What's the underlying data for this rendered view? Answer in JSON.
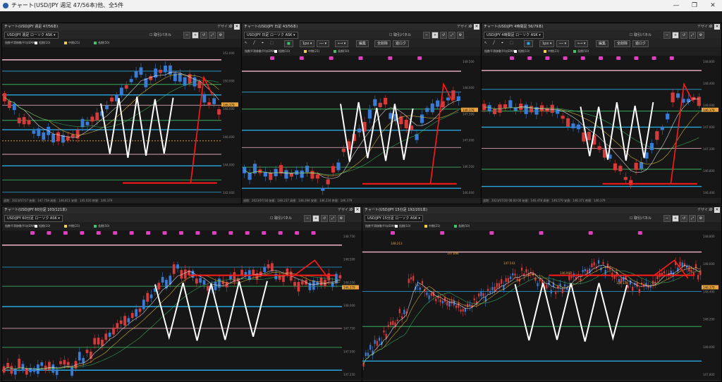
{
  "window": {
    "title": "チャート(USD/JPY 週足 47/56本)他、全5件",
    "min": "—",
    "max": "❐",
    "close": "✕"
  },
  "common": {
    "bid_label": "取引パネル",
    "design_label": "デザイン",
    "zoom_labels": [
      "−",
      "+",
      "↺",
      "⤢",
      "⚙"
    ],
    "sma_label": "指数平滑移動平均(EMA)",
    "ind_labels": [
      "短期(10)",
      "中期(21)",
      "長期(50)"
    ],
    "ind_colors": [
      "#ffffff",
      "#f5d142",
      "#3cc46b"
    ]
  },
  "colors": {
    "bull": "#d63a3a",
    "bear": "#3a7bd5",
    "pink": "#f5b6c8",
    "blue": "#29a8e0",
    "green": "#3cc46b",
    "orange": "#e8a33d",
    "magenta": "#e040c0",
    "drawn_red": "#ff1a1a",
    "drawn_white": "#ffffff"
  },
  "panels": [
    {
      "head": "チャート(USD/JPY 週足 47/56本)",
      "symbol": "USD/JPY 週足 ローソク ASK",
      "footer": "週期：2023/07/17 始値：147.758 高値：148.811 安値：145.020 終値：146.379",
      "axis": [
        "152.000",
        "150.000",
        "148.000",
        "146.000",
        "144.000",
        "142.000"
      ],
      "price_badge": "146.379",
      "tools": null,
      "signals": []
    },
    {
      "head": "チャート(USD/JPY 日足 43/56本)",
      "symbol": "USD/JPY 日足 ローソク ASK",
      "footer": "週期：2023/07/18 始値：148.237 高値：148.394 安値：146.234 終値：146.379",
      "axis": [
        "148.500",
        "148.000",
        "147.500",
        "147.000",
        "146.500",
        "146.000"
      ],
      "price_badge": "146.379",
      "tools": {
        "labels": [
          "編集",
          "全削除",
          "遊ロク"
        ],
        "unit": "1px"
      },
      "signals": [
        "S",
        "S",
        "S",
        "S",
        "S",
        "S"
      ]
    },
    {
      "head": "チャート(USD/JPY 4時間足 56/79本)",
      "symbol": "USD/JPY 4時間足 ローソク ASK",
      "footer": "週期：2023/07/20 08:00:00 始値：146.478 高値：146.570 安値：146.371 終値：146.379",
      "axis": [
        "148.800",
        "148.400",
        "148.000",
        "147.600",
        "147.200",
        "146.800",
        "146.400"
      ],
      "price_badge": "146.379",
      "tools": {
        "labels": [
          "編集",
          "全削除",
          "遊ロク"
        ],
        "unit": "1px"
      },
      "signals": [
        "L",
        "S",
        "L",
        "S",
        "L",
        "S",
        "S",
        "L",
        "S",
        "S"
      ]
    },
    {
      "head": "チャート(USD/JPY 60分足 103/121本)",
      "symbol": "USD/JPY 60分足 ローソク ASK",
      "footer": "",
      "axis": [
        "148.750",
        "148.500",
        "148.250",
        "148.000",
        "147.750",
        "147.500",
        "147.250"
      ],
      "price_badge": "146.379",
      "tools": null,
      "signals": [
        "L",
        "S",
        "L",
        "S",
        "L",
        "S",
        "L",
        "L",
        "S",
        "L",
        "S",
        "S",
        "S",
        "L",
        "S",
        "S",
        "L",
        "S"
      ]
    },
    {
      "head": "チャート(USD/JPY 15分足 192/201本)",
      "symbol": "USD/JPY 15分足 ローソク ASK",
      "footer": "",
      "axis": [
        "148.800",
        "148.600",
        "148.400",
        "148.200",
        "148.000",
        "147.800"
      ],
      "price_badge": "146.379",
      "tools": null,
      "signals": [
        "L",
        "S",
        "L",
        "S",
        "L",
        "S"
      ],
      "labels": [
        "148.213",
        "147.896",
        "147.543",
        "146.902",
        "146.128"
      ]
    }
  ]
}
